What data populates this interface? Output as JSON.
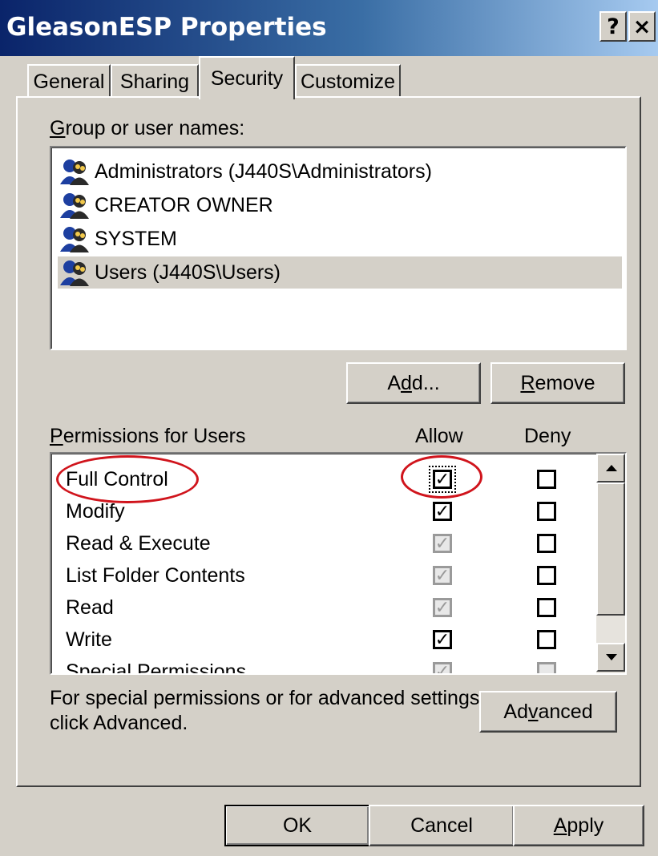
{
  "window": {
    "title": "GleasonESP Properties",
    "help_glyph": "?",
    "close_glyph": "×"
  },
  "tabs": [
    {
      "label": "General",
      "active": false
    },
    {
      "label": "Sharing",
      "active": false
    },
    {
      "label": "Security",
      "active": true
    },
    {
      "label": "Customize",
      "active": false
    }
  ],
  "users": {
    "label_accel": "G",
    "label_rest": "roup or user names:",
    "items": [
      {
        "name": "Administrators (J440S\\Administrators)",
        "selected": false
      },
      {
        "name": "CREATOR OWNER",
        "selected": false
      },
      {
        "name": "SYSTEM",
        "selected": false
      },
      {
        "name": "Users (J440S\\Users)",
        "selected": true
      }
    ],
    "add_pre": "A",
    "add_accel": "d",
    "add_post": "d...",
    "remove_accel": "R",
    "remove_post": "emove"
  },
  "permissions": {
    "label_accel": "P",
    "label_rest": "ermissions for Users",
    "allow_header": "Allow",
    "deny_header": "Deny",
    "items": [
      {
        "name": "Full Control",
        "allow": true,
        "allow_disabled": false,
        "deny": false
      },
      {
        "name": "Modify",
        "allow": true,
        "allow_disabled": false,
        "deny": false
      },
      {
        "name": "Read & Execute",
        "allow": true,
        "allow_disabled": true,
        "deny": false
      },
      {
        "name": "List Folder Contents",
        "allow": true,
        "allow_disabled": true,
        "deny": false
      },
      {
        "name": "Read",
        "allow": true,
        "allow_disabled": true,
        "deny": false
      },
      {
        "name": "Write",
        "allow": true,
        "allow_disabled": false,
        "deny": false
      },
      {
        "name": "Special Permissions",
        "allow": true,
        "allow_disabled": true,
        "deny": false
      }
    ]
  },
  "advanced": {
    "note_line1": "For special permissions or for advanced settings,",
    "note_line2": "click Advanced.",
    "btn_pre": "Ad",
    "btn_accel": "v",
    "btn_post": "anced"
  },
  "footer": {
    "ok": "OK",
    "cancel": "Cancel",
    "apply_accel": "A",
    "apply_post": "pply"
  },
  "colors": {
    "annotation": "#d0141c",
    "title_start": "#0a246a",
    "title_end": "#a6caf0",
    "face": "#d4d0c8"
  }
}
